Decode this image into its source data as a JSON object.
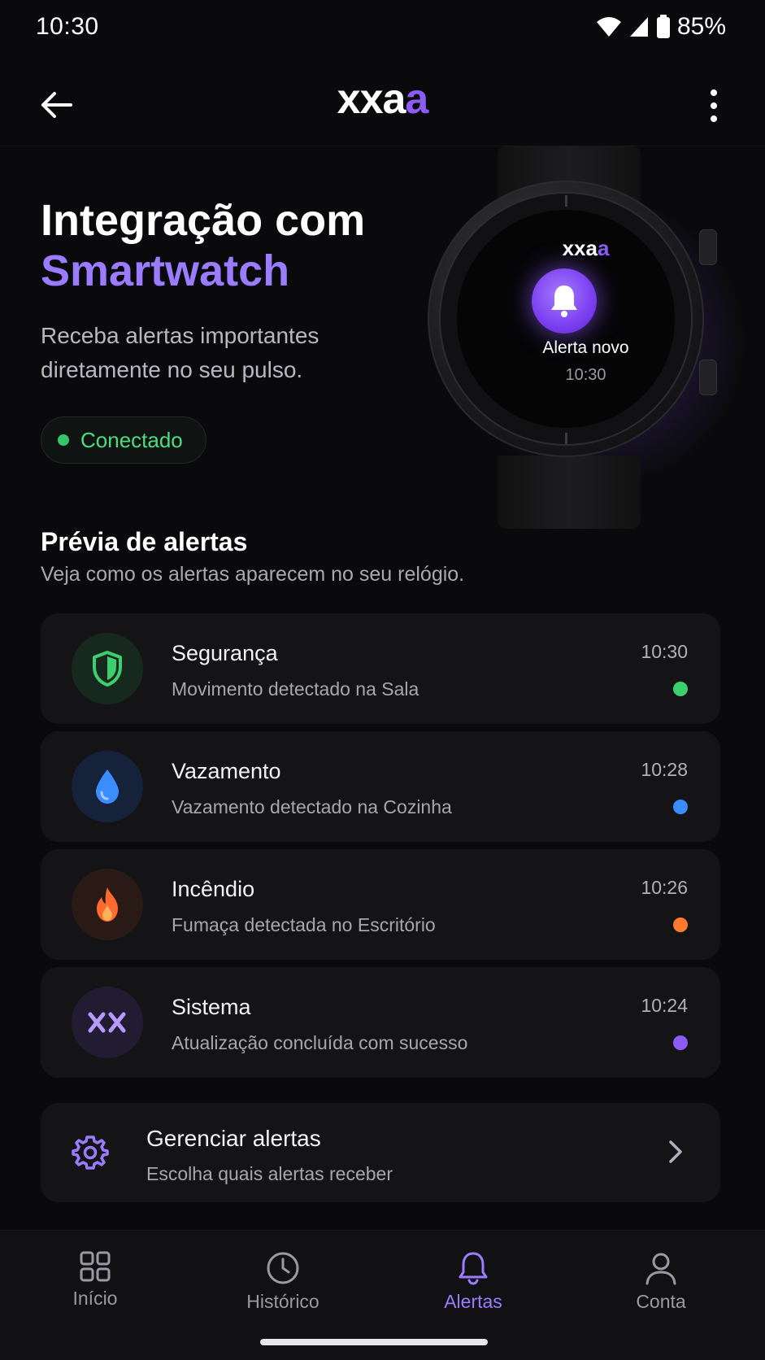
{
  "status_bar": {
    "time": "10:30",
    "battery": "85%"
  },
  "app_bar": {
    "logo_white": "xxa",
    "logo_purple": "a"
  },
  "hero": {
    "title_line1": "Integração com",
    "title_line2": "Smartwatch",
    "subtitle": "Receba alertas importantes diretamente no seu pulso.",
    "status_label": "Conectado"
  },
  "watch": {
    "logo_white": "xxa",
    "logo_purple": "a",
    "alert_label": "Alerta novo",
    "alert_time": "10:30"
  },
  "preview": {
    "title": "Prévia de alertas",
    "subtitle": "Veja como os alertas aparecem no seu relógio.",
    "alerts": [
      {
        "title": "Segurança",
        "description": "Movimento detectado na Sala",
        "time": "10:30",
        "icon": "shield-icon",
        "color": "#3ccf6e"
      },
      {
        "title": "Vazamento",
        "description": "Vazamento detectado na Cozinha",
        "time": "10:28",
        "icon": "water-drop-icon",
        "color": "#3b8cff"
      },
      {
        "title": "Incêndio",
        "description": "Fumaça detectada no Escritório",
        "time": "10:26",
        "icon": "flame-icon",
        "color": "#ff7a2f"
      },
      {
        "title": "Sistema",
        "description": "Atualização concluída com sucesso",
        "time": "10:24",
        "icon": "xx-logo-icon",
        "color": "#8b5cf6"
      }
    ]
  },
  "manage": {
    "title": "Gerenciar alertas",
    "subtitle": "Escolha quais alertas receber"
  },
  "nav": {
    "items": [
      {
        "label": "Início",
        "icon": "grid-icon",
        "active": false
      },
      {
        "label": "Histórico",
        "icon": "clock-icon",
        "active": false
      },
      {
        "label": "Alertas",
        "icon": "bell-icon",
        "active": true
      },
      {
        "label": "Conta",
        "icon": "user-icon",
        "active": false
      }
    ]
  }
}
